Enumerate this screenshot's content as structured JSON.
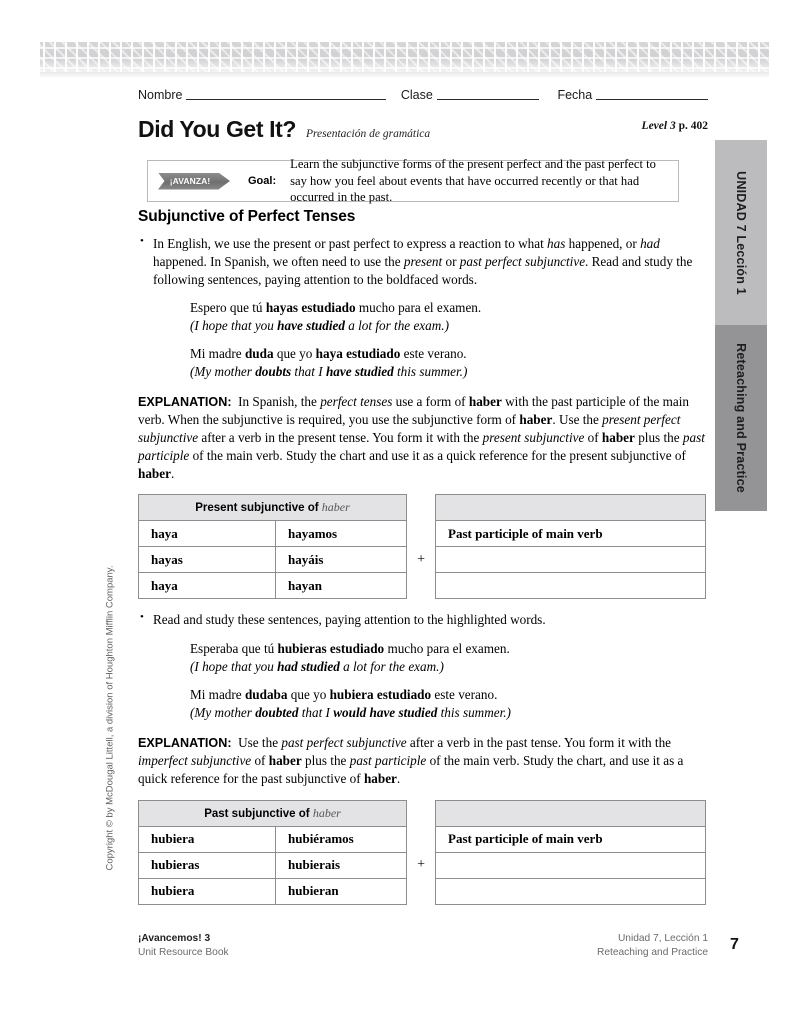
{
  "header": {
    "nombre_label": "Nombre",
    "clase_label": "Clase",
    "fecha_label": "Fecha",
    "title": "Did You Get It?",
    "subtitle": "Presentación de gramática",
    "level_label": "Level 3",
    "page_ref": "p. 402"
  },
  "goal_box": {
    "badge": "¡AVANZA!",
    "goal_label": "Goal:",
    "goal_text": "Learn the subjunctive forms of the present perfect and the past perfect to say how you feel about events that have occurred recently or that had occurred in the past."
  },
  "section": {
    "heading": "Subjunctive of Perfect Tenses"
  },
  "bullet1": {
    "text": "In English, we use the present or past perfect to express a reaction to what has happened, or had happened. In Spanish, we often need to use the present or past perfect subjunctive. Read and study the following sentences, paying attention to the boldfaced words."
  },
  "examples1": [
    {
      "spanish": "Espero que tú hayas estudiado mucho para el examen.",
      "english": "(I hope that you have studied a lot for the exam.)"
    },
    {
      "spanish": "Mi madre duda que yo haya estudiado este verano.",
      "english": "(My mother doubts that I have studied this summer.)"
    }
  ],
  "explanation1": {
    "label": "EXPLANATION:",
    "text": "In Spanish, the perfect tenses use a form of haber with the past participle of the main verb. When the subjunctive is required, you use the subjunctive form of haber. Use the present perfect subjunctive after a verb in the present tense. You form it with the present subjunctive of haber plus the past participle of the main verb. Study the chart and use it as a quick reference for the present subjunctive of haber."
  },
  "table1": {
    "header": "Present subjunctive of",
    "header_italic": "haber",
    "plus": "+",
    "right_header": "Past participle of main verb",
    "rows": [
      {
        "col1": "haya",
        "col2": "hayamos"
      },
      {
        "col1": "hayas",
        "col2": "hayáis"
      },
      {
        "col1": "haya",
        "col2": "hayan"
      }
    ]
  },
  "bullet2": {
    "text": "Read and study these sentences, paying attention to the highlighted words."
  },
  "examples2": [
    {
      "spanish": "Esperaba que tú hubieras estudiado mucho para el examen.",
      "english": "(I hope that you had studied a lot for the exam.)"
    },
    {
      "spanish": "Mi madre dudaba que yo hubiera estudiado este verano.",
      "english": "(My mother doubted that I would have studied this summer.)"
    }
  ],
  "explanation2": {
    "label": "EXPLANATION:",
    "text": "Use the past perfect subjunctive after a verb in the past tense. You form it with the imperfect subjunctive of haber plus the past participle of the main verb. Study the chart, and use it as a quick reference for the past subjunctive of haber."
  },
  "table2": {
    "header": "Past subjunctive of",
    "header_italic": "haber",
    "plus": "+",
    "right_header": "Past participle of main verb",
    "rows": [
      {
        "col1": "hubiera",
        "col2": "hubiéramos"
      },
      {
        "col1": "hubieras",
        "col2": "hubierais"
      },
      {
        "col1": "hubiera",
        "col2": "hubieran"
      }
    ]
  },
  "side_tabs": {
    "unidad": "UNIDAD 7 Lección 1",
    "reteaching": "Reteaching and Practice"
  },
  "copyright": "Copyright © by McDougal Littell, a division of Houghton Mifflin Company.",
  "footer": {
    "book_title": "¡Avancemos!",
    "book_level": "3",
    "book_sub": "Unit Resource Book",
    "unit_line": "Unidad 7, Lección 1",
    "section_line": "Reteaching and Practice",
    "page_number": "7"
  }
}
